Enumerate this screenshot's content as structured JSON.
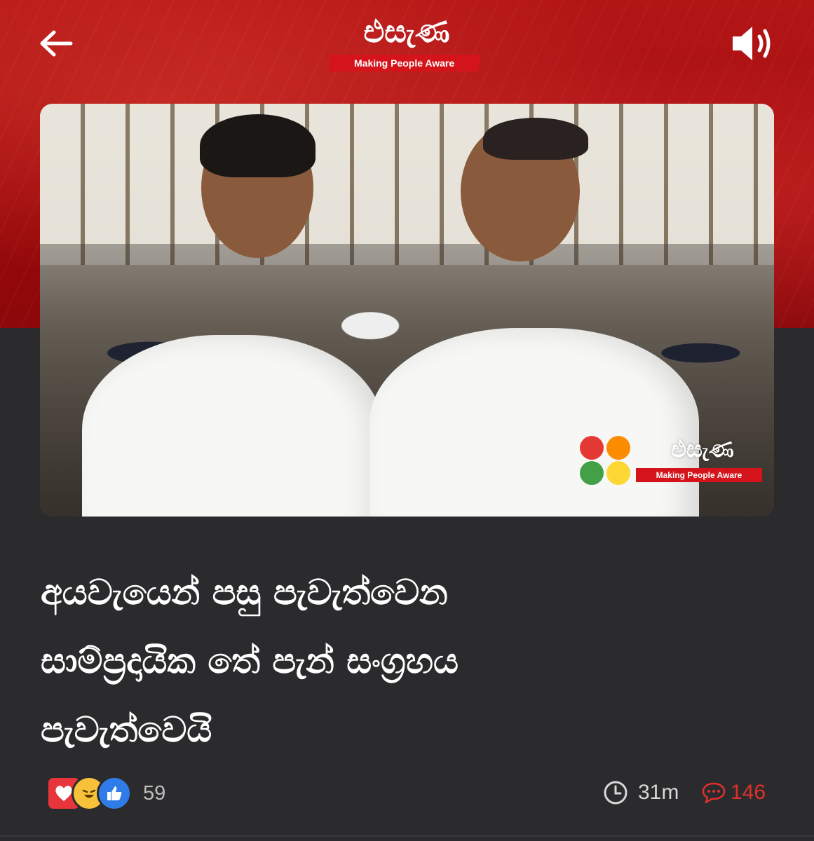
{
  "header": {
    "brand_name": "එසැණ",
    "brand_tagline": "Making People Aware",
    "back_icon": "arrow-left-icon",
    "speaker_icon": "speaker-icon"
  },
  "article": {
    "image_watermark": {
      "brand_name": "එසැණ",
      "tagline": "Making People Aware",
      "dot_colors": [
        "#e53935",
        "#fb8c00",
        "#43a047",
        "#fdd835"
      ]
    },
    "headline_lines": [
      "අයවැයෙන් පසු පැවැත්වෙන",
      "සාම්ප්‍රදායික තේ පැන් සංග්‍රහය",
      "පැවැත්වෙයි"
    ]
  },
  "footer": {
    "reactions": {
      "icons": [
        "love-reaction-icon",
        "haha-reaction-icon",
        "like-reaction-icon"
      ],
      "count": "59"
    },
    "time_ago": "31m",
    "comments": "146"
  },
  "colors": {
    "header_red": "#a50f12",
    "background": "#2b2b2d",
    "comment_red": "#e0302c"
  }
}
